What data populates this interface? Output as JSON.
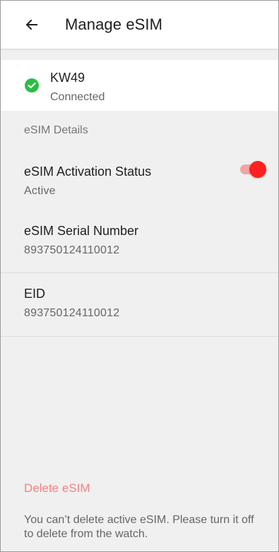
{
  "header": {
    "title": "Manage eSIM",
    "back_icon": "arrow-left-icon"
  },
  "device": {
    "name": "KW49",
    "status": "Connected",
    "status_icon": "check-circle-icon",
    "status_color": "#2bbd45"
  },
  "section": {
    "title": "eSIM Details"
  },
  "details": [
    {
      "label": "eSIM Activation Status",
      "value": "Active",
      "toggle": {
        "enabled": true,
        "accent": "#ff2020",
        "track": "#f4a3a5"
      }
    },
    {
      "label": "eSIM Serial Number",
      "value": "893750124110012"
    },
    {
      "label": "EID",
      "value": "893750124110012"
    }
  ],
  "footer": {
    "delete_label": "Delete eSIM",
    "help_text": "You can’t delete active eSIM. Please turn it off to delete from the watch."
  },
  "colors": {
    "background": "#f0f0f0",
    "card": "#ffffff",
    "danger": "#f08383"
  }
}
